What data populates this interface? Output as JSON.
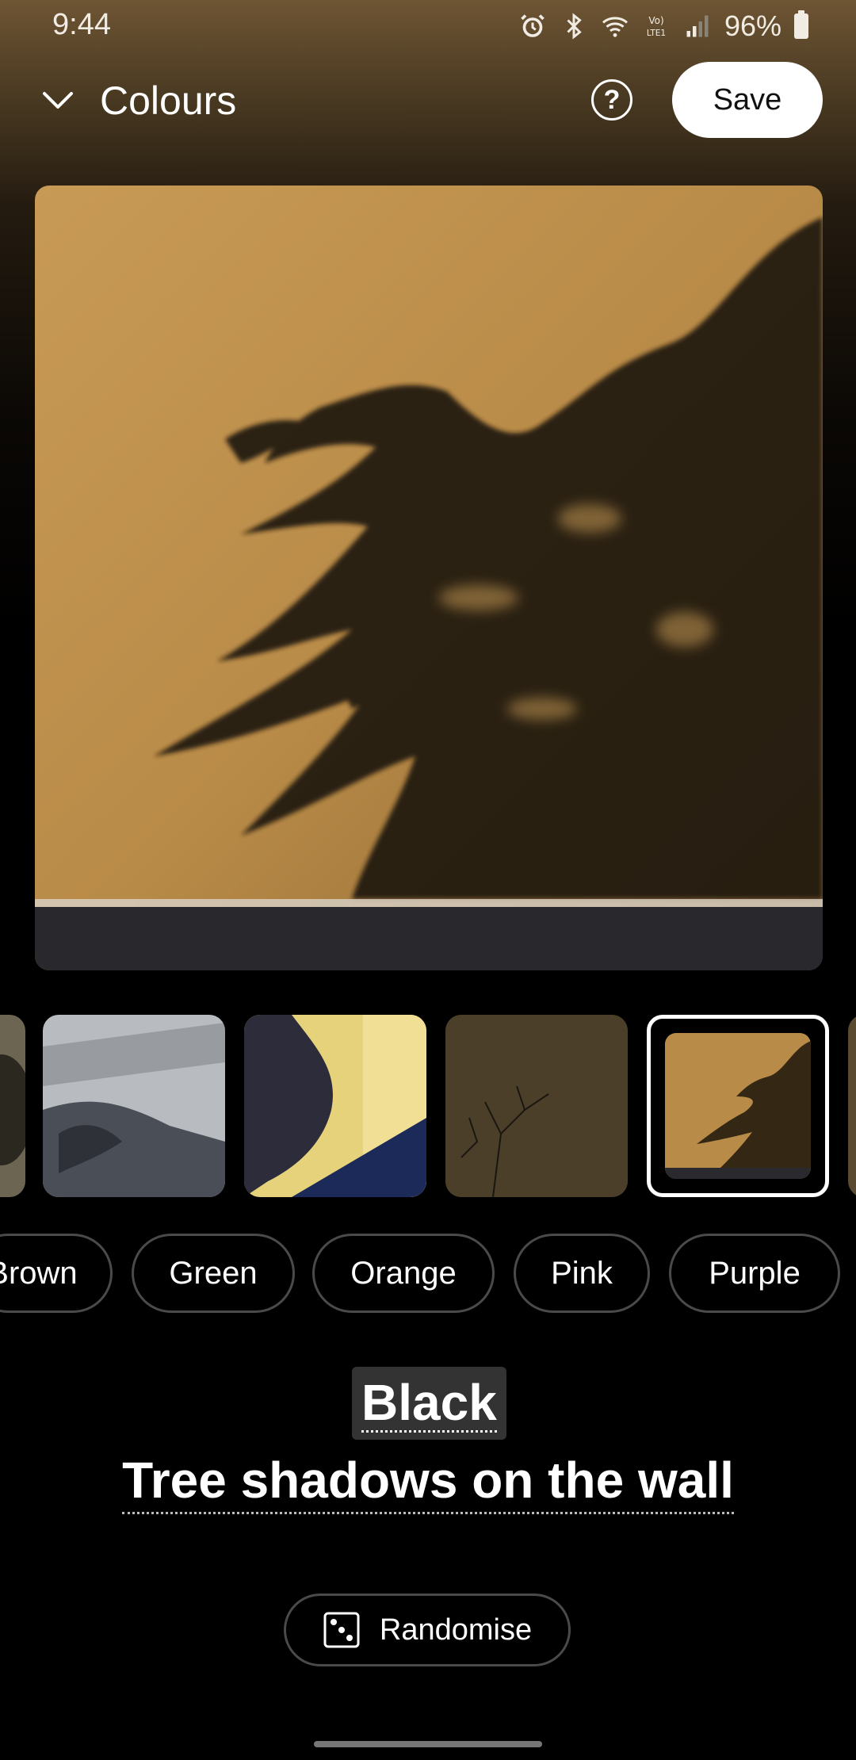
{
  "status_bar": {
    "time": "9:44",
    "battery": "96%",
    "icons": [
      "alarm-icon",
      "bluetooth-icon",
      "wifi-icon",
      "volte-icon",
      "signal-icon",
      "battery-icon"
    ]
  },
  "header": {
    "title": "Colours",
    "save_label": "Save",
    "help_glyph": "?"
  },
  "thumbnails": [
    {
      "name": "thumb-partial-left",
      "selected": false
    },
    {
      "name": "thumb-grey-leaves",
      "selected": false
    },
    {
      "name": "thumb-yellow-wall-tree",
      "selected": false
    },
    {
      "name": "thumb-dark-branches",
      "selected": false
    },
    {
      "name": "thumb-tree-shadows",
      "selected": true
    }
  ],
  "chips": [
    "Brown",
    "Green",
    "Orange",
    "Pink",
    "Purple"
  ],
  "selection": {
    "category": "Black",
    "subtitle": "Tree shadows on the wall"
  },
  "randomise_label": "Randomise",
  "colors": {
    "accent": "#ffffff",
    "chip_border": "#4a4a4a",
    "label_bg": "#333333",
    "wall": "#b98b48"
  }
}
